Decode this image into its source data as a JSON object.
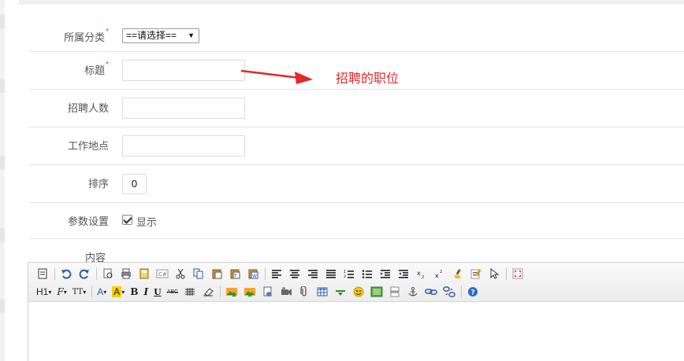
{
  "form": {
    "category": {
      "label": "所属分类",
      "required_mark": "*",
      "selected": "==请选择=="
    },
    "title": {
      "label": "标题",
      "required_mark": "*",
      "value": ""
    },
    "headcount": {
      "label": "招聘人数",
      "value": ""
    },
    "location": {
      "label": "工作地点",
      "value": ""
    },
    "order": {
      "label": "排序",
      "value": "0"
    },
    "params": {
      "label": "参数设置",
      "checkbox_label": "显示",
      "checked": true
    },
    "content": {
      "label": "内容"
    }
  },
  "annotation": {
    "text": "招聘的职位",
    "color": "#e5282a"
  },
  "editor": {
    "toolbar_row1": [
      "source-icon",
      "undo-icon",
      "redo-icon",
      "preview-icon",
      "print-icon",
      "template-icon",
      "code-icon",
      "cut-icon",
      "copy-icon",
      "paste-icon",
      "paste-text-icon",
      "paste-word-icon",
      "align-left-icon",
      "align-center-icon",
      "align-right-icon",
      "align-justify-icon",
      "ordered-list-icon",
      "unordered-list-icon",
      "indent-icon",
      "outdent-icon",
      "subscript-icon",
      "superscript-icon",
      "clear-format-icon",
      "select-all-icon",
      "select-icon",
      "fullscreen-icon"
    ],
    "toolbar_row2": {
      "heading": "H1",
      "font": "F",
      "size": "TT",
      "forecolor": "A",
      "hilitecolor": "A",
      "bold": "B",
      "italic": "I",
      "underline": "U",
      "strikethrough": "ABC"
    }
  }
}
